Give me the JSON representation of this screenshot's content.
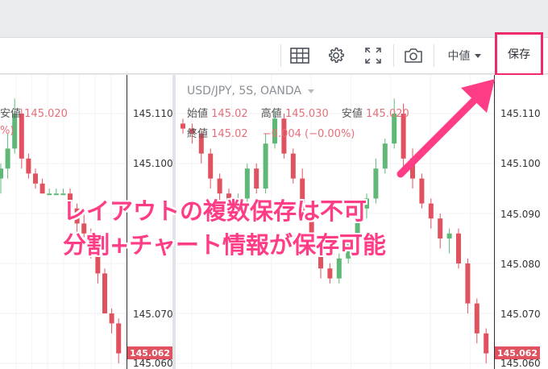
{
  "toolbar": {
    "median_label": "中値",
    "save_label": "保存"
  },
  "legend_right": {
    "symbol": "USD/JPY, 5S, OANDA",
    "open_key": "始値",
    "open_val": "145.02",
    "high_key": "高値",
    "high_val": "145.030",
    "low_key": "安値",
    "low_val": "145.020",
    "close_key": "終値",
    "close_val": "145.02",
    "change": "−0.004 (−0.00%)"
  },
  "legend_left": {
    "low_key": "安値",
    "low_val": "145.020",
    "pct_fragment": "%)"
  },
  "axis_left": [
    "145.110",
    "145.100",
    "145.090",
    "145.080",
    "145.070",
    "145.060"
  ],
  "axis_right": [
    "145.110",
    "145.100",
    "145.090",
    "145.080",
    "145.070",
    "145.060"
  ],
  "last_price": "145.062",
  "annotation": {
    "line1": "レイアウトの複数保存は不可",
    "line2": "分割+チャート情報が保存可能"
  },
  "colors": {
    "up": "#5fb876",
    "down": "#e0525f",
    "highlight": "#ee2a6b",
    "callout": "#ff3d86"
  },
  "chart_data": [
    {
      "type": "candlestick",
      "title": "",
      "y_ticks": [
        145.11,
        145.1,
        145.09,
        145.08,
        145.07,
        145.06
      ],
      "candles": [
        {
          "o": 145.097,
          "h": 145.1,
          "l": 145.094,
          "c": 145.099
        },
        {
          "o": 145.099,
          "h": 145.106,
          "l": 145.097,
          "c": 145.103
        },
        {
          "o": 145.103,
          "h": 145.113,
          "l": 145.102,
          "c": 145.11
        },
        {
          "o": 145.11,
          "h": 145.111,
          "l": 145.099,
          "c": 145.101
        },
        {
          "o": 145.101,
          "h": 145.102,
          "l": 145.097,
          "c": 145.098
        },
        {
          "o": 145.098,
          "h": 145.099,
          "l": 145.095,
          "c": 145.096
        },
        {
          "o": 145.096,
          "h": 145.097,
          "l": 145.094,
          "c": 145.094
        },
        {
          "o": 145.094,
          "h": 145.095,
          "l": 145.094,
          "c": 145.094
        },
        {
          "o": 145.094,
          "h": 145.095,
          "l": 145.094,
          "c": 145.094
        },
        {
          "o": 145.094,
          "h": 145.095,
          "l": 145.094,
          "c": 145.094
        },
        {
          "o": 145.094,
          "h": 145.095,
          "l": 145.09,
          "c": 145.091
        },
        {
          "o": 145.091,
          "h": 145.092,
          "l": 145.086,
          "c": 145.088
        },
        {
          "o": 145.088,
          "h": 145.09,
          "l": 145.084,
          "c": 145.086
        },
        {
          "o": 145.086,
          "h": 145.087,
          "l": 145.081,
          "c": 145.082
        },
        {
          "o": 145.082,
          "h": 145.083,
          "l": 145.076,
          "c": 145.078
        },
        {
          "o": 145.078,
          "h": 145.079,
          "l": 145.071,
          "c": 145.07
        },
        {
          "o": 145.07,
          "h": 145.071,
          "l": 145.066,
          "c": 145.068
        },
        {
          "o": 145.068,
          "h": 145.069,
          "l": 145.06,
          "c": 145.062
        }
      ]
    },
    {
      "type": "candlestick",
      "title": "USD/JPY, 5S, OANDA",
      "y_ticks": [
        145.11,
        145.1,
        145.09,
        145.08,
        145.07,
        145.06
      ],
      "candles": [
        {
          "o": 145.108,
          "h": 145.109,
          "l": 145.106,
          "c": 145.107
        },
        {
          "o": 145.107,
          "h": 145.108,
          "l": 145.104,
          "c": 145.106
        },
        {
          "o": 145.106,
          "h": 145.107,
          "l": 145.1,
          "c": 145.102
        },
        {
          "o": 145.102,
          "h": 145.103,
          "l": 145.095,
          "c": 145.097
        },
        {
          "o": 145.097,
          "h": 145.098,
          "l": 145.092,
          "c": 145.094
        },
        {
          "o": 145.094,
          "h": 145.095,
          "l": 145.09,
          "c": 145.092
        },
        {
          "o": 145.092,
          "h": 145.094,
          "l": 145.091,
          "c": 145.093
        },
        {
          "o": 145.093,
          "h": 145.1,
          "l": 145.092,
          "c": 145.099
        },
        {
          "o": 145.099,
          "h": 145.1,
          "l": 145.094,
          "c": 145.095
        },
        {
          "o": 145.095,
          "h": 145.106,
          "l": 145.094,
          "c": 145.104
        },
        {
          "o": 145.104,
          "h": 145.111,
          "l": 145.103,
          "c": 145.109
        },
        {
          "o": 145.109,
          "h": 145.11,
          "l": 145.101,
          "c": 145.102
        },
        {
          "o": 145.102,
          "h": 145.103,
          "l": 145.096,
          "c": 145.097
        },
        {
          "o": 145.097,
          "h": 145.099,
          "l": 145.089,
          "c": 145.09
        },
        {
          "o": 145.09,
          "h": 145.091,
          "l": 145.082,
          "c": 145.084
        },
        {
          "o": 145.084,
          "h": 145.085,
          "l": 145.077,
          "c": 145.079
        },
        {
          "o": 145.079,
          "h": 145.08,
          "l": 145.076,
          "c": 145.077
        },
        {
          "o": 145.077,
          "h": 145.082,
          "l": 145.076,
          "c": 145.081
        },
        {
          "o": 145.081,
          "h": 145.086,
          "l": 145.08,
          "c": 145.085
        },
        {
          "o": 145.085,
          "h": 145.092,
          "l": 145.084,
          "c": 145.091
        },
        {
          "o": 145.091,
          "h": 145.094,
          "l": 145.089,
          "c": 145.093
        },
        {
          "o": 145.093,
          "h": 145.101,
          "l": 145.092,
          "c": 145.099
        },
        {
          "o": 145.099,
          "h": 145.105,
          "l": 145.098,
          "c": 145.104
        },
        {
          "o": 145.104,
          "h": 145.113,
          "l": 145.103,
          "c": 145.11
        },
        {
          "o": 145.11,
          "h": 145.112,
          "l": 145.099,
          "c": 145.101
        },
        {
          "o": 145.101,
          "h": 145.103,
          "l": 145.095,
          "c": 145.097
        },
        {
          "o": 145.097,
          "h": 145.098,
          "l": 145.091,
          "c": 145.092
        },
        {
          "o": 145.092,
          "h": 145.093,
          "l": 145.087,
          "c": 145.089
        },
        {
          "o": 145.089,
          "h": 145.09,
          "l": 145.083,
          "c": 145.085
        },
        {
          "o": 145.085,
          "h": 145.087,
          "l": 145.082,
          "c": 145.086
        },
        {
          "o": 145.086,
          "h": 145.087,
          "l": 145.079,
          "c": 145.08
        },
        {
          "o": 145.08,
          "h": 145.081,
          "l": 145.07,
          "c": 145.072
        },
        {
          "o": 145.072,
          "h": 145.073,
          "l": 145.064,
          "c": 145.066
        },
        {
          "o": 145.066,
          "h": 145.067,
          "l": 145.06,
          "c": 145.062
        }
      ]
    }
  ]
}
